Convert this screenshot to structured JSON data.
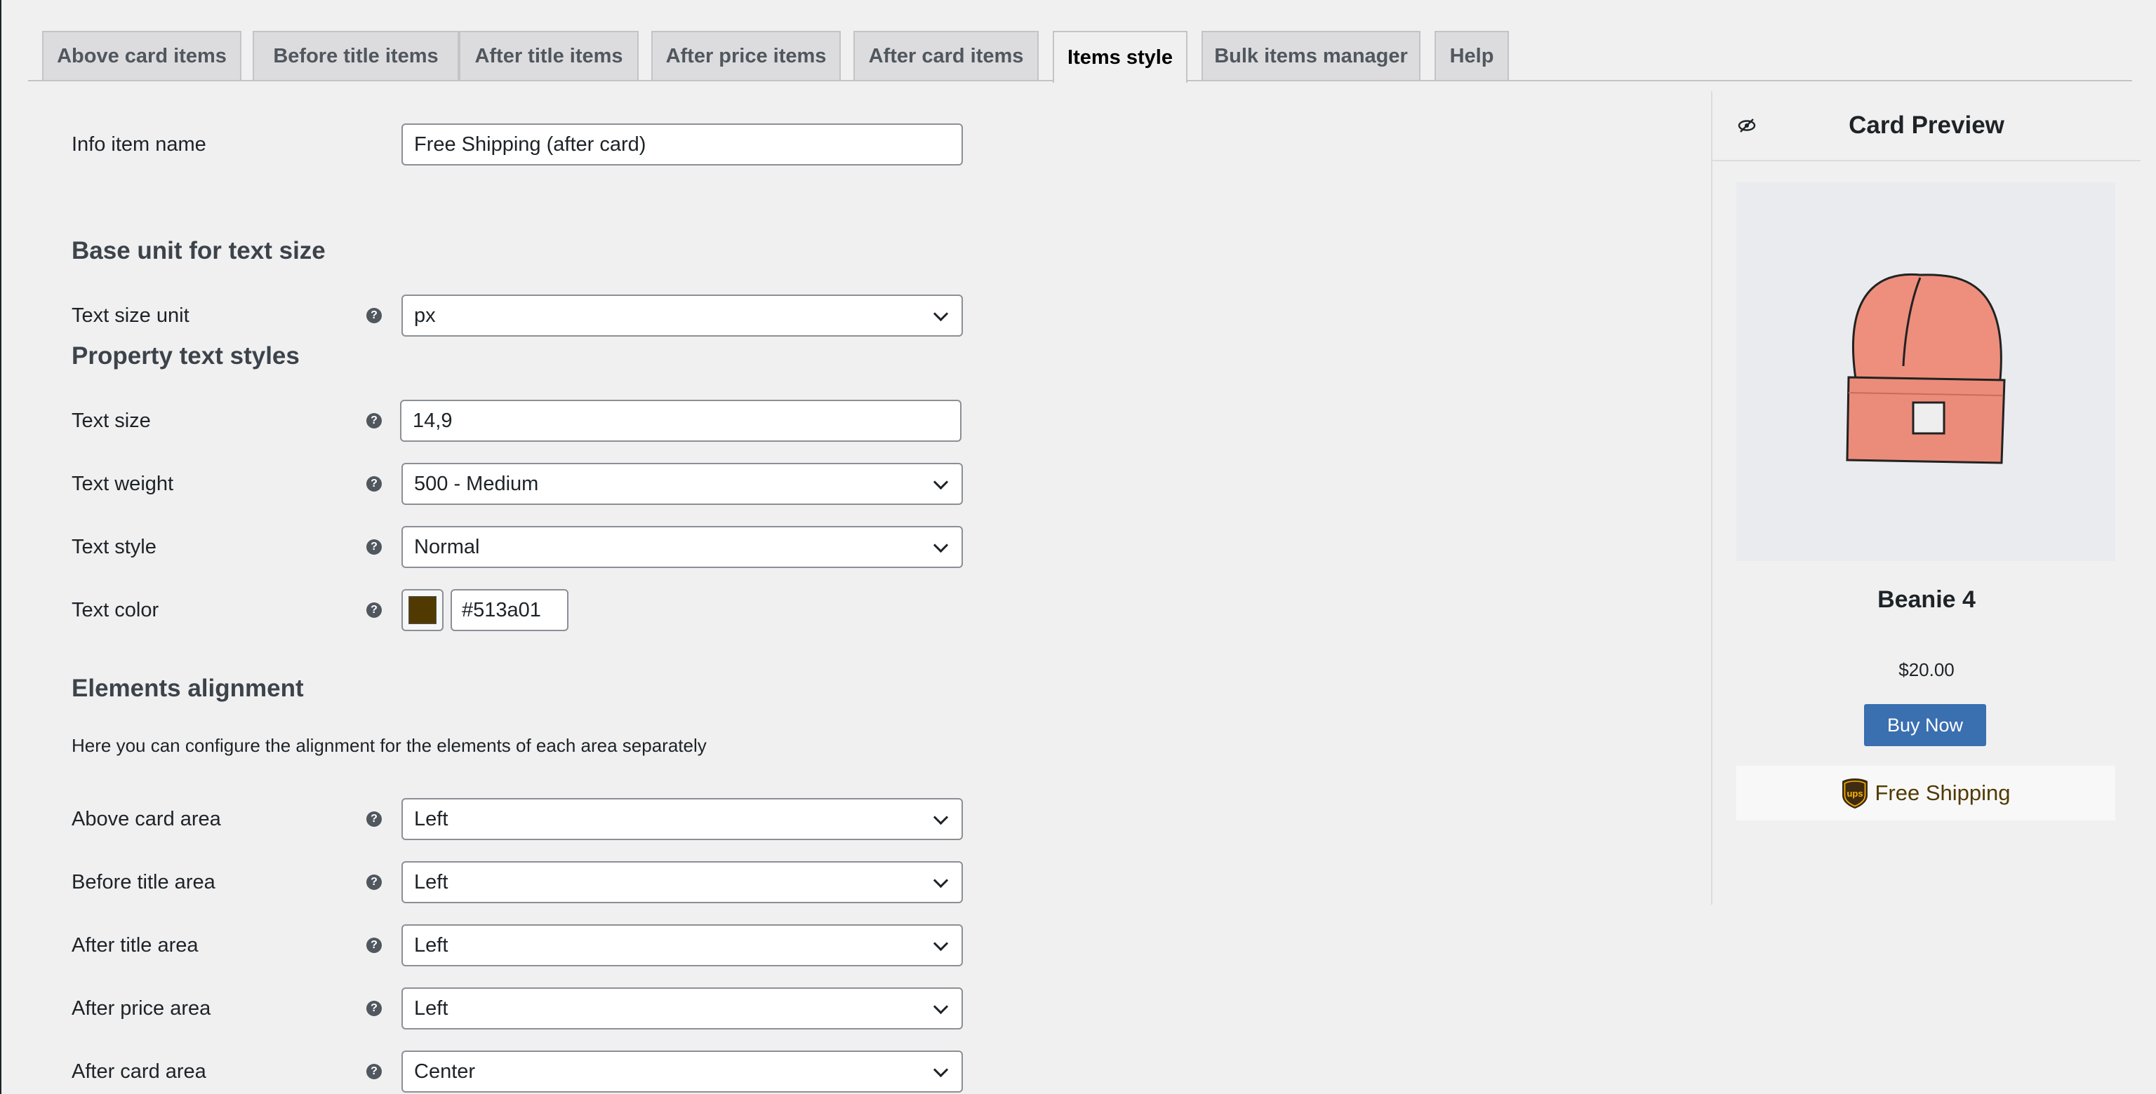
{
  "tabs": [
    {
      "label": "Above card items",
      "active": false
    },
    {
      "label": "Before title items",
      "active": false
    },
    {
      "label": "After title items",
      "active": false
    },
    {
      "label": "After price items",
      "active": false
    },
    {
      "label": "After card items",
      "active": false
    },
    {
      "label": "Items style",
      "active": true
    },
    {
      "label": "Bulk items manager",
      "active": false
    },
    {
      "label": "Help",
      "active": false
    }
  ],
  "form": {
    "info_item_name": {
      "label": "Info item name",
      "value": "Free Shipping (after card)"
    },
    "base_unit_heading": "Base unit for text size",
    "text_size_unit": {
      "label": "Text size unit",
      "value": "px"
    },
    "property_styles_heading": "Property text styles",
    "text_size": {
      "label": "Text size",
      "value": "14,9"
    },
    "text_weight": {
      "label": "Text weight",
      "value": "500 - Medium"
    },
    "text_style": {
      "label": "Text style",
      "value": "Normal"
    },
    "text_color": {
      "label": "Text color",
      "value": "#513a01"
    },
    "alignment_heading": "Elements alignment",
    "alignment_description": "Here you can configure the alignment for the elements of each area separately",
    "above_card_area": {
      "label": "Above card area",
      "value": "Left"
    },
    "before_title_area": {
      "label": "Before title area",
      "value": "Left"
    },
    "after_title_area": {
      "label": "After title area",
      "value": "Left"
    },
    "after_price_area": {
      "label": "After price area",
      "value": "Left"
    },
    "after_card_area": {
      "label": "After card area",
      "value": "Center"
    }
  },
  "help_glyph": "?",
  "preview": {
    "title": "Card Preview",
    "product_name": "Beanie 4",
    "price": "$20.00",
    "buy_label": "Buy Now",
    "after_card_item": {
      "text": "Free Shipping",
      "icon": "ups-logo-icon"
    },
    "icons": {
      "header": "eye-slash-icon",
      "image": "beanie-hat-image"
    }
  },
  "colors": {
    "button_blue": "#3a6fb0",
    "text_color_swatch": "#513a01",
    "background": "#f0f0f1"
  }
}
